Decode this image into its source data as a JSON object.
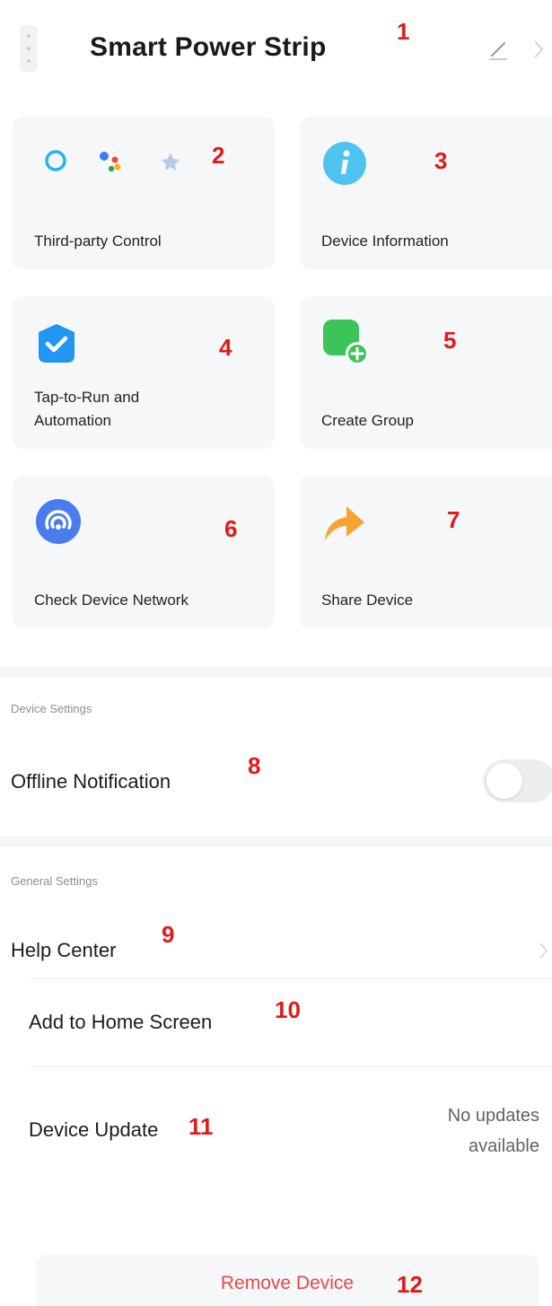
{
  "header": {
    "title": "Smart Power Strip",
    "annotation": "1"
  },
  "tiles": [
    {
      "label": "Third-party Control",
      "annotation": "2",
      "icon": "voice-assistants-icon"
    },
    {
      "label": "Device Information",
      "annotation": "3",
      "icon": "info-icon"
    },
    {
      "label_lines": [
        "Tap-to-Run and",
        "Automation"
      ],
      "annotation": "4",
      "icon": "automation-check-icon"
    },
    {
      "label": "Create Group",
      "annotation": "5",
      "icon": "create-group-icon"
    },
    {
      "label": "Check Device Network",
      "annotation": "6",
      "icon": "network-signal-icon"
    },
    {
      "label": "Share Device",
      "annotation": "7",
      "icon": "share-arrow-icon"
    }
  ],
  "device_settings": {
    "section_label": "Device Settings",
    "offline_notification": {
      "label": "Offline Notification",
      "annotation": "8",
      "enabled": false
    }
  },
  "general_settings": {
    "section_label": "General Settings",
    "help_center": {
      "label": "Help Center",
      "annotation": "9"
    },
    "add_to_home": {
      "label": "Add to Home Screen",
      "annotation": "10"
    },
    "device_update": {
      "label": "Device Update",
      "annotation": "11",
      "status_lines": [
        "No updates",
        "available"
      ]
    }
  },
  "remove_device": {
    "label": "Remove Device",
    "annotation": "12"
  },
  "colors": {
    "accent_red": "#e84848",
    "annotation_red": "#e01919",
    "card_bg": "#f5f7f8",
    "info_blue": "#4fc3f0",
    "automation_blue": "#2196f3",
    "group_green": "#3cc35a",
    "network_blue": "#4a7cf0",
    "share_orange": "#f7a532"
  }
}
